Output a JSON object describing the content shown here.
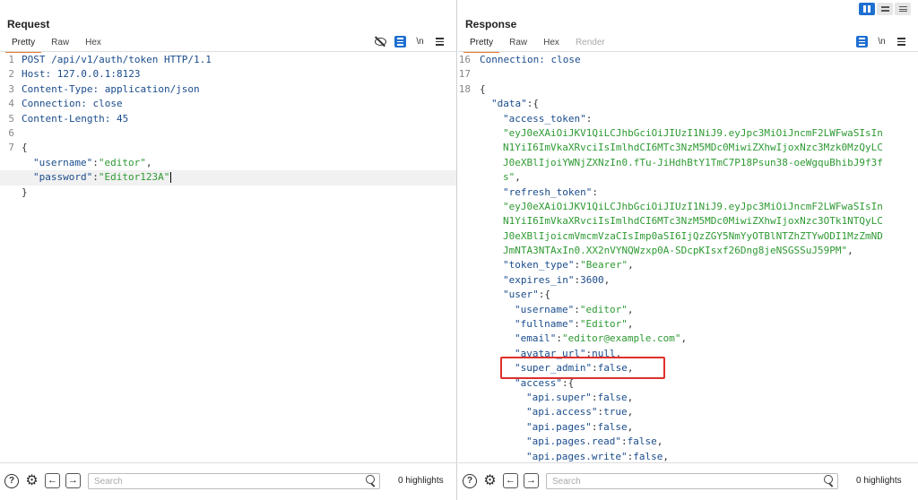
{
  "request": {
    "title": "Request",
    "tabs": [
      "Pretty",
      "Raw",
      "Hex"
    ],
    "tools": {
      "hide_icon": "eye-slash-icon",
      "wrap_label": "\\n"
    },
    "lines": [
      {
        "n": "1",
        "text": "POST /api/v1/auth/token HTTP/1.1"
      },
      {
        "n": "2",
        "text": "Host: 127.0.0.1:8123"
      },
      {
        "n": "3",
        "text": "Content-Type: application/json"
      },
      {
        "n": "4",
        "text": "Connection: close"
      },
      {
        "n": "5",
        "text": "Content-Length: 45"
      },
      {
        "n": "6",
        "text": ""
      },
      {
        "n": "7",
        "text": "{"
      },
      {
        "n": "",
        "key": "\"username\"",
        "sep": ":",
        "val": "\"editor\"",
        "end": ","
      },
      {
        "n": "",
        "key": "\"password\"",
        "sep": ":",
        "val": "\"Editor123A\"",
        "end": ""
      },
      {
        "n": "",
        "text": "}"
      }
    ],
    "search_placeholder": "Search",
    "highlights": "0 highlights"
  },
  "response": {
    "title": "Response",
    "tabs": [
      "Pretty",
      "Raw",
      "Hex",
      "Render"
    ],
    "tools": {
      "wrap_label": "\\n"
    },
    "lines": [
      {
        "n": "16",
        "text": "Connection: close"
      },
      {
        "n": "17",
        "text": ""
      },
      {
        "n": "18",
        "text": "{"
      },
      {
        "n": "",
        "indent": 1,
        "key": "\"data\"",
        "sep": ":",
        "val": "{",
        "valtype": "p"
      },
      {
        "n": "",
        "indent": 2,
        "key": "\"access_token\"",
        "sep": ":"
      },
      {
        "n": "",
        "indent": 2,
        "val": "\"eyJ0eXAiOiJKV1QiLCJhbGciOiJIUzI1NiJ9.eyJpc3MiOiJncmF2LWFwaSIsIn"
      },
      {
        "n": "",
        "indent": 2,
        "val": "N1YiI6ImVkaXRvciIsImlhdCI6MTc3NzM5MDc0MiwiZXhwIjoxNzc3Mzk0MzQyLC"
      },
      {
        "n": "",
        "indent": 2,
        "val": "J0eXBlIjoiYWNjZXNzIn0.fTu-JiHdhBtY1TmC7P18Psun38-oeWgquBhibJ9f3f"
      },
      {
        "n": "",
        "indent": 2,
        "val": "s\"",
        "end": ","
      },
      {
        "n": "",
        "indent": 2,
        "key": "\"refresh_token\"",
        "sep": ":"
      },
      {
        "n": "",
        "indent": 2,
        "val": "\"eyJ0eXAiOiJKV1QiLCJhbGciOiJIUzI1NiJ9.eyJpc3MiOiJncmF2LWFwaSIsIn"
      },
      {
        "n": "",
        "indent": 2,
        "val": "N1YiI6ImVkaXRvciIsImlhdCI6MTc3NzM5MDc0MiwiZXhwIjoxNzc3OTk1NTQyLC"
      },
      {
        "n": "",
        "indent": 2,
        "val": "J0eXBlIjoicmVmcmVzaCIsImp0aSI6IjQzZGY5NmYyOTBlNTZhZTYwODI1MzZmND"
      },
      {
        "n": "",
        "indent": 2,
        "val": "JmNTA3NTAxIn0.XX2nVYNQWzxp0A-SDcpKIsxf26Dng8jeNSGSSuJ59PM\"",
        "end": ","
      },
      {
        "n": "",
        "indent": 2,
        "key": "\"token_type\"",
        "sep": ":",
        "val": "\"Bearer\"",
        "end": ","
      },
      {
        "n": "",
        "indent": 2,
        "key": "\"expires_in\"",
        "sep": ":",
        "val": "3600",
        "valtype": "t",
        "end": ","
      },
      {
        "n": "",
        "indent": 2,
        "key": "\"user\"",
        "sep": ":",
        "val": "{",
        "valtype": "p"
      },
      {
        "n": "",
        "indent": 3,
        "key": "\"username\"",
        "sep": ":",
        "val": "\"editor\"",
        "end": ","
      },
      {
        "n": "",
        "indent": 3,
        "key": "\"fullname\"",
        "sep": ":",
        "val": "\"Editor\"",
        "end": ","
      },
      {
        "n": "",
        "indent": 3,
        "key": "\"email\"",
        "sep": ":",
        "val": "\"editor@example.com\"",
        "end": ","
      },
      {
        "n": "",
        "indent": 3,
        "key": "\"avatar_url\"",
        "sep": ":",
        "val": "null",
        "valtype": "t",
        "end": ","
      },
      {
        "n": "",
        "indent": 3,
        "key": "\"super_admin\"",
        "sep": ":",
        "val": "false",
        "valtype": "t",
        "end": ","
      },
      {
        "n": "",
        "indent": 3,
        "key": "\"access\"",
        "sep": ":",
        "val": "{",
        "valtype": "p"
      },
      {
        "n": "",
        "indent": 4,
        "key": "\"api.super\"",
        "sep": ":",
        "val": "false",
        "valtype": "t",
        "end": ","
      },
      {
        "n": "",
        "indent": 4,
        "key": "\"api.access\"",
        "sep": ":",
        "val": "true",
        "valtype": "t",
        "end": ","
      },
      {
        "n": "",
        "indent": 4,
        "key": "\"api.pages\"",
        "sep": ":",
        "val": "false",
        "valtype": "t",
        "end": ","
      },
      {
        "n": "",
        "indent": 4,
        "key": "\"api.pages.read\"",
        "sep": ":",
        "val": "false",
        "valtype": "t",
        "end": ","
      },
      {
        "n": "",
        "indent": 4,
        "key": "\"api.pages.write\"",
        "sep": ":",
        "val": "false",
        "valtype": "t",
        "end": ","
      }
    ],
    "search_placeholder": "Search",
    "highlights": "0 highlights"
  },
  "colors": {
    "accent": "#1f6fd1",
    "tab_underline": "#e8792d",
    "annotation": "#e0302c",
    "string": "#2e9a33",
    "key": "#1a4c8c"
  }
}
